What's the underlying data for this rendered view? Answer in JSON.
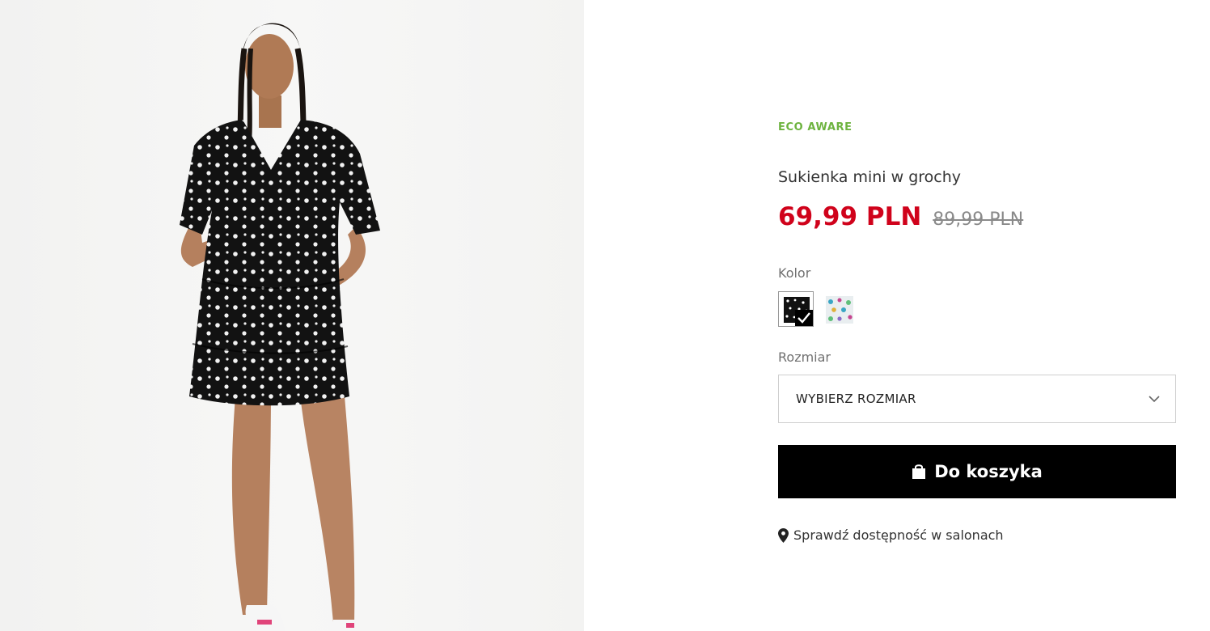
{
  "product": {
    "badge": "ECO AWARE",
    "name": "Sukienka mini w grochy",
    "price": "69,99 PLN",
    "old_price": "89,99 PLN",
    "image_icon": "product-photo"
  },
  "color": {
    "label": "Kolor",
    "options": [
      {
        "icon": "polka-dot-swatch",
        "selected": true
      },
      {
        "icon": "floral-swatch",
        "selected": false
      }
    ]
  },
  "size": {
    "label": "Rozmiar",
    "select_placeholder": "WYBIERZ ROZMIAR",
    "icon": "chevron-down-icon"
  },
  "actions": {
    "add_to_cart": "Do koszyka",
    "cart_icon": "shopping-bag-icon",
    "check_stores": "Sprawdź dostępność w salonach",
    "stores_icon": "map-pin-icon"
  },
  "colors": {
    "price": "#d0021b",
    "eco": "#6db33f",
    "button": "#000000"
  }
}
